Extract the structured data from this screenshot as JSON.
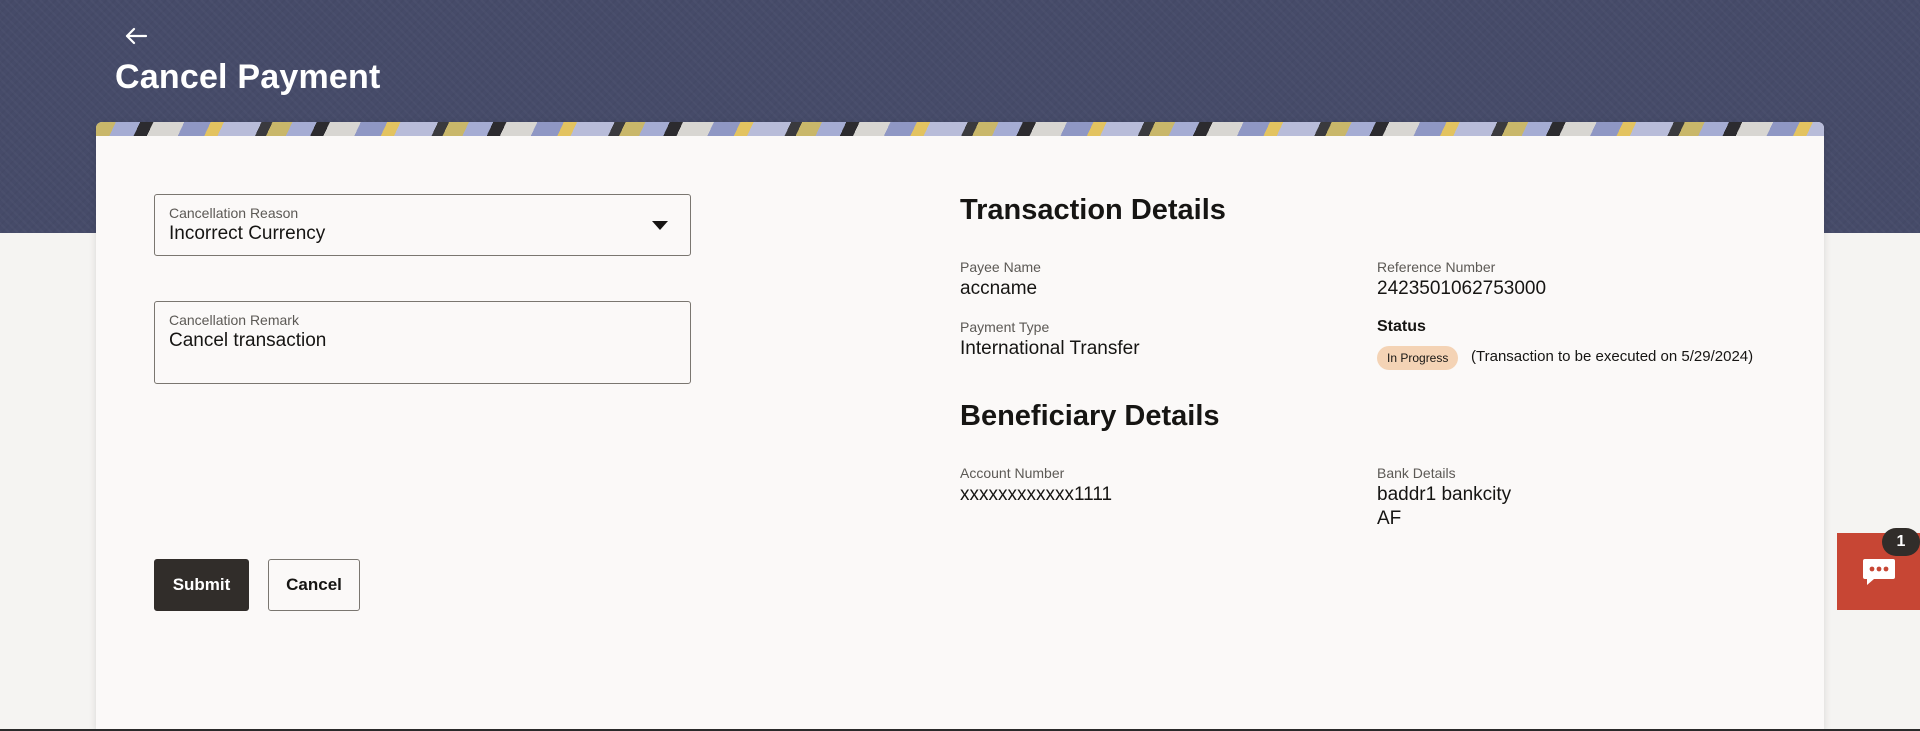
{
  "header": {
    "title": "Cancel Payment",
    "back_icon": "arrow-left-icon"
  },
  "form": {
    "reason": {
      "label": "Cancellation Reason",
      "value": "Incorrect Currency"
    },
    "remark": {
      "label": "Cancellation Remark",
      "value": "Cancel transaction"
    },
    "submit_label": "Submit",
    "cancel_label": "Cancel"
  },
  "transaction": {
    "title": "Transaction Details",
    "payee_name_label": "Payee Name",
    "payee_name": "accname",
    "reference_label": "Reference Number",
    "reference": "2423501062753000",
    "payment_type_label": "Payment Type",
    "payment_type": "International Transfer",
    "status_label": "Status",
    "status": "In Progress",
    "status_note": "(Transaction to be executed on 5/29/2024)"
  },
  "beneficiary": {
    "title": "Beneficiary Details",
    "account_label": "Account Number",
    "account": "xxxxxxxxxxxx1111",
    "bank_label": "Bank Details",
    "bank_line1": "baddr1 bankcity",
    "bank_line2": "AF"
  },
  "chat": {
    "count": "1",
    "icon": "chat-bubble-icon"
  },
  "colors": {
    "header_bg": "#464b69",
    "primary_button": "#312d2a",
    "status_badge": "#f4d3b5",
    "chat_widget": "#c74634"
  }
}
